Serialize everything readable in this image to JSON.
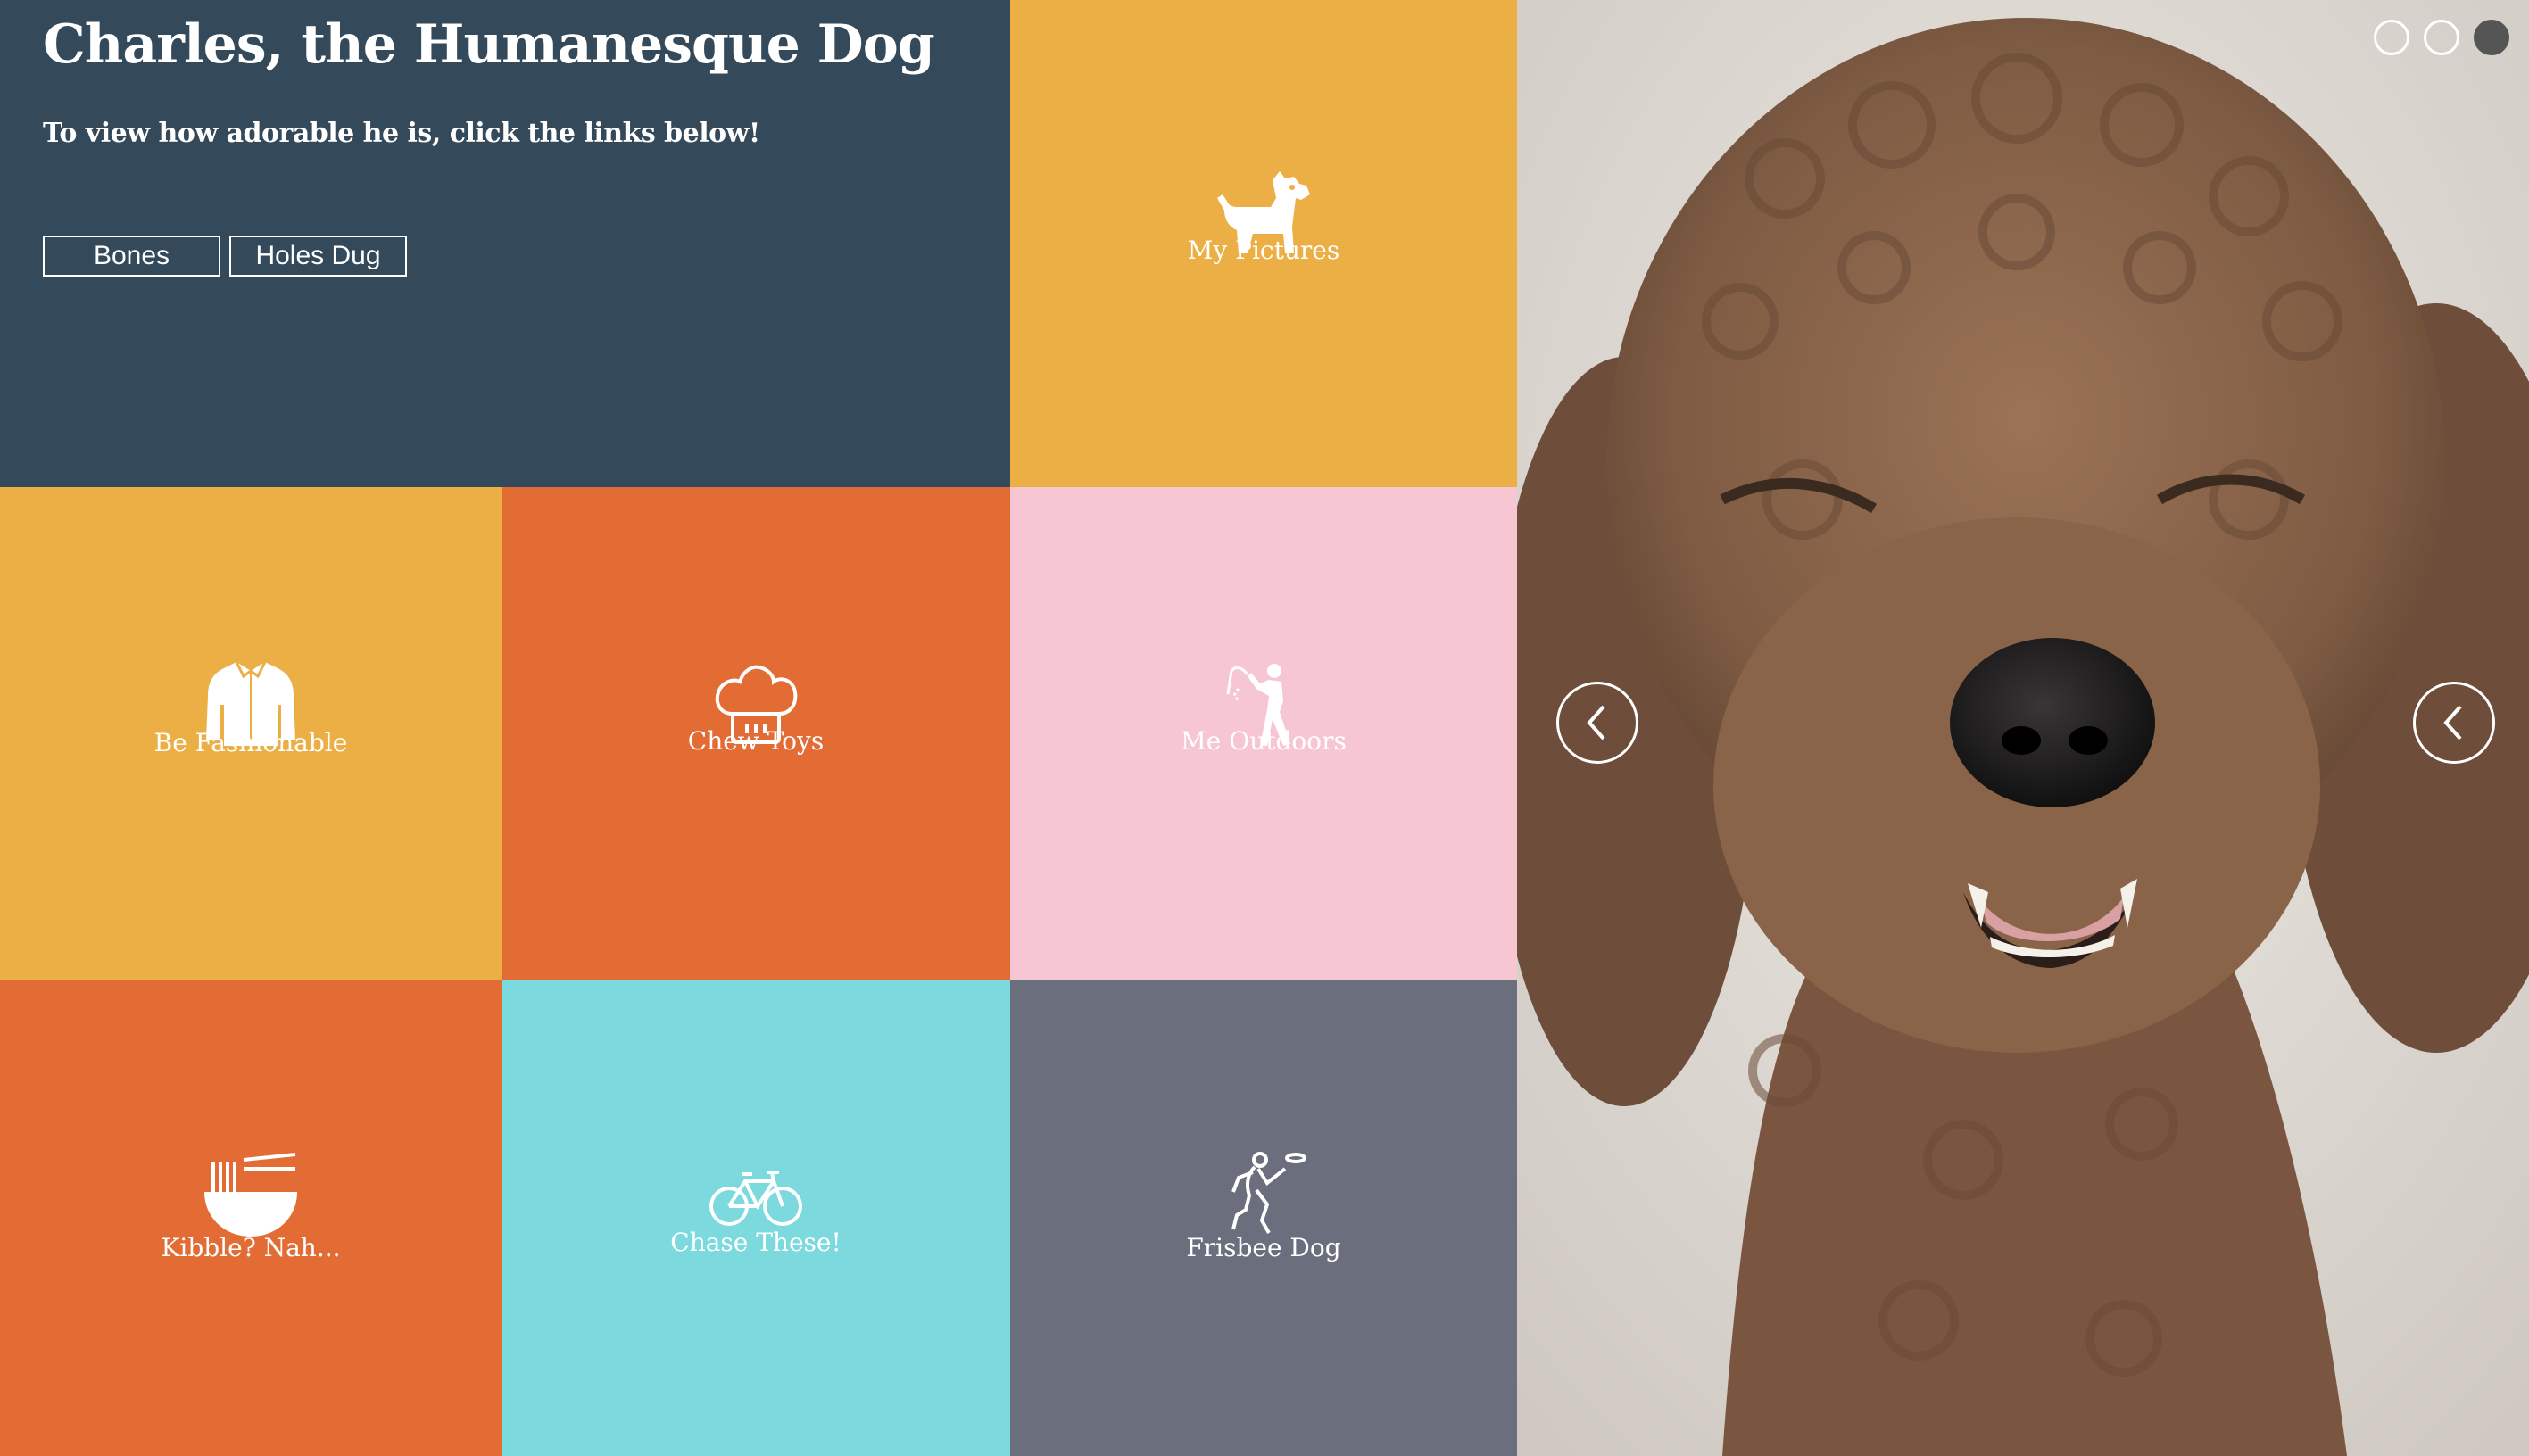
{
  "header": {
    "title": "Charles, the Humanesque Dog",
    "subtitle": "To view how adorable he is, click the links below!",
    "buttons": {
      "bones": "Bones",
      "holes_dug": "Holes Dug"
    },
    "background": "#34495a"
  },
  "tiles": [
    {
      "label": "My Pictures",
      "icon": "dog-icon",
      "color": "#ebaf46"
    },
    {
      "label": "Be Fashionable",
      "icon": "shirt-icon",
      "color": "#ebaf46"
    },
    {
      "label": "Chew Toys",
      "icon": "chef-hat-icon",
      "color": "#e36b34"
    },
    {
      "label": "Me Outdoors",
      "icon": "golfer-icon",
      "color": "#f7c6d3"
    },
    {
      "label": "Kibble? Nah...",
      "icon": "noodle-bowl-icon",
      "color": "#e36b34"
    },
    {
      "label": "Chase These!",
      "icon": "bicycle-icon",
      "color": "#7cdadf"
    },
    {
      "label": "Frisbee Dog",
      "icon": "frisbee-player-icon",
      "color": "#6b6f7d"
    }
  ],
  "carousel": {
    "slide_count": 3,
    "active_slide": 3,
    "image": "poodle-face-photo"
  }
}
